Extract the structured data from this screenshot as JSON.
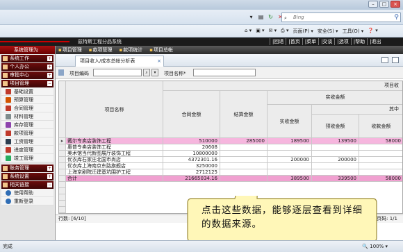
{
  "browser": {
    "search_placeholder": "Bing",
    "commands": [
      "页面(P) ▾",
      "安全(S) ▾",
      "工具(O) ▾",
      "❓ ▾"
    ],
    "status": "完成",
    "zoom": "🔍 100% ▾"
  },
  "app": {
    "name": "兹特斯工程分品系统",
    "topnav": [
      "|回退",
      "|首页",
      "|菜单",
      "|交谈",
      "|选项",
      "|帮助",
      "|退出"
    ]
  },
  "menubar": {
    "items": [
      "项目管理",
      "款项管理",
      "款项统计",
      "项目总帐"
    ]
  },
  "sidebar": {
    "title": "系统管理为",
    "sections_top": [
      {
        "label": "系统工作"
      },
      {
        "label": "个人办公"
      },
      {
        "label": "审批中心"
      },
      {
        "label": "项目管理"
      }
    ],
    "items": [
      {
        "label": "基础设置",
        "color": "#c0392b"
      },
      {
        "label": "预算管理",
        "color": "#d35400"
      },
      {
        "label": "合同管理",
        "color": "#c0392b"
      },
      {
        "label": "材料管理",
        "color": "#7f8c8d"
      },
      {
        "label": "库存管理",
        "color": "#8e44ad"
      },
      {
        "label": "款项管理",
        "color": "#c0392b"
      },
      {
        "label": "工资管理",
        "color": "#2c3e50"
      },
      {
        "label": "进度管理",
        "color": "#c0392b"
      },
      {
        "label": "竣工管理",
        "color": "#27ae60"
      }
    ],
    "sections_bottom": [
      {
        "label": "账务管理"
      },
      {
        "label": "系统设置"
      },
      {
        "label": "相关链接"
      }
    ],
    "links": [
      {
        "label": "使用帮助",
        "color": "#2f6db5"
      },
      {
        "label": "重新登录",
        "color": "#2f6db5"
      }
    ]
  },
  "panel": {
    "tab_title": "项目收入/成本总帐分析表",
    "tab_close": "×",
    "filter_code_label": "项目编码",
    "filter_name_label": "项目名称*",
    "rowcount": "行数: [6/10]",
    "pageinfo": "页码: 1/1"
  },
  "grid": {
    "headers": {
      "top_right": "项目收",
      "name": "项目名称",
      "contract": "合同金额",
      "settle": "结算金额",
      "actual_group": "实收金额",
      "actual": "实收金额",
      "prepay": "预收金额",
      "progress": "收款金额",
      "other": "其中"
    },
    "rows": [
      {
        "name": "戴尔专卖店装饰工程",
        "contract": "510000",
        "settle": "285000",
        "actual": "189500",
        "prepay": "139500",
        "progress": "58000",
        "highlight": true
      },
      {
        "name": "惠普专卖店装饰工程",
        "contract": "20608",
        "settle": "",
        "actual": "",
        "prepay": "",
        "progress": "",
        "highlight": false
      },
      {
        "name": "美术馆当代新图展厅装饰工程",
        "contract": "10800000",
        "settle": "",
        "actual": "",
        "prepay": "",
        "progress": "",
        "highlight": false
      },
      {
        "name": "优衣库石家庄北国市尚店",
        "contract": "4372301.16",
        "settle": "",
        "actual": "200000",
        "prepay": "200000",
        "progress": "",
        "highlight": false
      },
      {
        "name": "优衣库上海南京东路旗舰店",
        "contract": "3250000",
        "settle": "",
        "actual": "",
        "prepay": "",
        "progress": "",
        "highlight": false
      },
      {
        "name": "上海京剧院迁建基坑围护工程",
        "contract": "2712125",
        "settle": "",
        "actual": "",
        "prepay": "",
        "progress": "",
        "highlight": false
      }
    ],
    "total": {
      "name": "合计",
      "contract": "21665034.16",
      "settle": "",
      "actual": "389500",
      "prepay": "339500",
      "progress": "58000"
    }
  },
  "callout": {
    "text": "点击这些数据，能够逐层查看到详细的数据来源。"
  }
}
